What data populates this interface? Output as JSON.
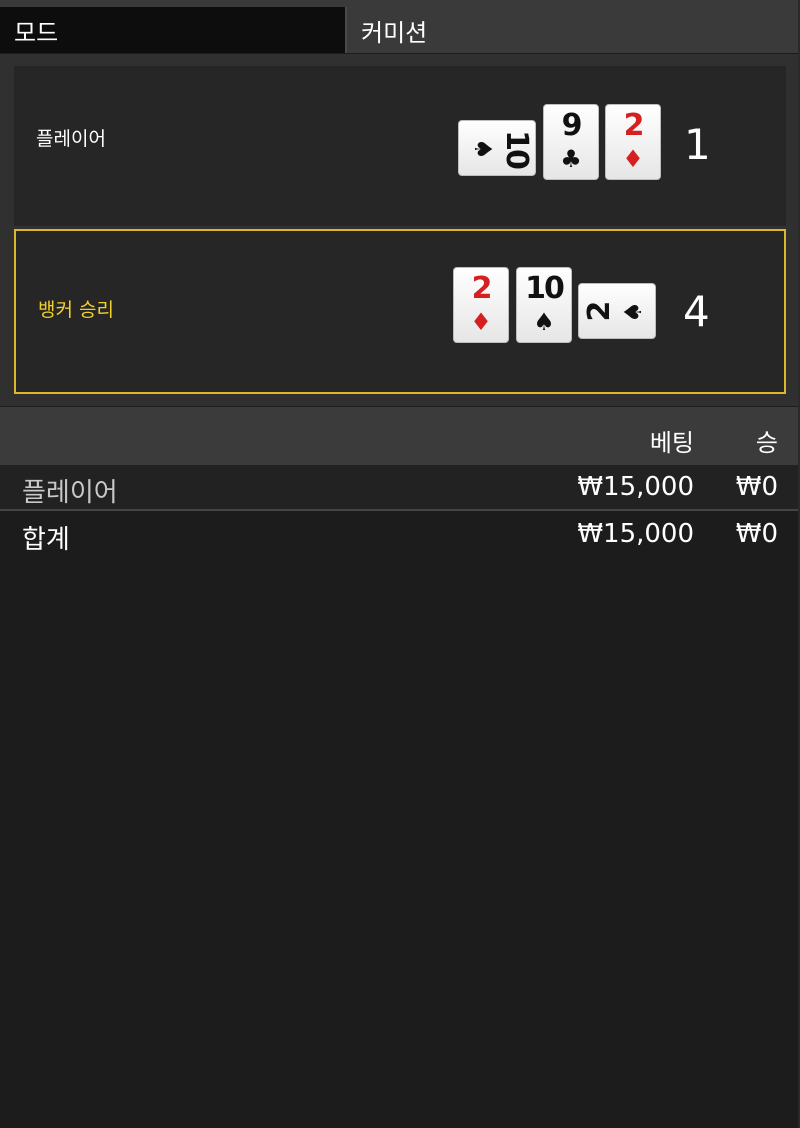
{
  "header": {
    "mode_label": "모드",
    "commission_label": "커미션"
  },
  "result": {
    "player": {
      "label": "플레이어",
      "score": "1",
      "cards": [
        {
          "rank": "10",
          "suit": "♠",
          "color": "#111111",
          "orientation": "sideways"
        },
        {
          "rank": "9",
          "suit": "♣",
          "color": "#111111",
          "orientation": "upright"
        },
        {
          "rank": "2",
          "suit": "♦",
          "color": "#d42020",
          "orientation": "upright"
        }
      ]
    },
    "banker": {
      "label": "뱅커 승리",
      "score": "4",
      "cards": [
        {
          "rank": "2",
          "suit": "♦",
          "color": "#d42020",
          "orientation": "upright"
        },
        {
          "rank": "10",
          "suit": "♠",
          "color": "#111111",
          "orientation": "upright"
        },
        {
          "rank": "2",
          "suit": "♠",
          "color": "#111111",
          "orientation": "sideways"
        }
      ]
    },
    "winner_highlight_color": "#d9b92b"
  },
  "bets": {
    "columns": {
      "bet": "베팅",
      "win": "승"
    },
    "rows": [
      {
        "name": "플레이어",
        "bet": "₩15,000",
        "win": "₩0"
      }
    ],
    "total": {
      "name": "합계",
      "bet": "₩15,000",
      "win": "₩0"
    }
  }
}
